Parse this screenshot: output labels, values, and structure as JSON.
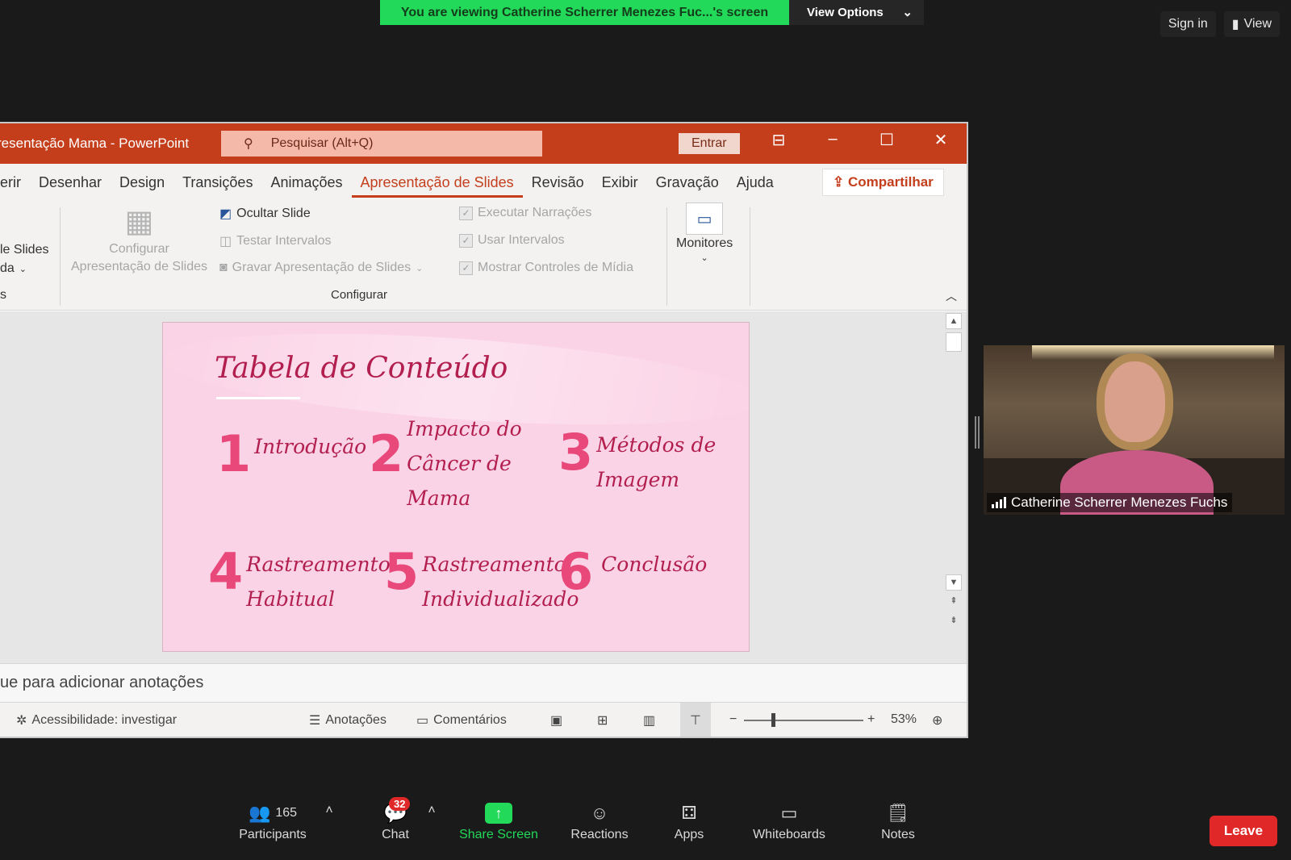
{
  "zoom": {
    "banner_text": "You are viewing Catherine Scherrer Menezes Fuc...'s screen",
    "view_options": "View Options",
    "sign_in": "Sign in",
    "view": "View",
    "participant_name": "Catherine Scherrer Menezes Fuchs",
    "toolbar": {
      "participants_label": "Participants",
      "participants_count": "165",
      "chat_label": "Chat",
      "chat_badge": "32",
      "share_label": "Share Screen",
      "reactions_label": "Reactions",
      "apps_label": "Apps",
      "whiteboards_label": "Whiteboards",
      "notes_label": "Notes",
      "leave_label": "Leave"
    }
  },
  "ppt": {
    "doc_title": "resentação Mama  -  PowerPoint",
    "search_placeholder": "Pesquisar (Alt+Q)",
    "entrar": "Entrar",
    "tabs": [
      "erir",
      "Desenhar",
      "Design",
      "Transições",
      "Animações",
      "Apresentação de Slides",
      "Revisão",
      "Exibir",
      "Gravação",
      "Ajuda"
    ],
    "share": "Compartilhar",
    "ribbon": {
      "left_cut_1": "le Slides",
      "left_cut_2": "da",
      "left_cut_3": "s",
      "configurar_line1": "Configurar",
      "configurar_line2": "Apresentação de Slides",
      "ocultar": "Ocultar Slide",
      "testar": "Testar Intervalos",
      "gravar": "Gravar Apresentação de Slides",
      "executar": "Executar Narrações",
      "usar": "Usar Intervalos",
      "mostrar": "Mostrar Controles de Mídia",
      "monitores": "Monitores",
      "group_label": "Configurar"
    },
    "slide": {
      "title": "Tabela de Conteúdo",
      "items": [
        {
          "num": "1",
          "label": "Introdução"
        },
        {
          "num": "2",
          "label": "Impacto do Câncer de Mama"
        },
        {
          "num": "3",
          "label": "Métodos de Imagem"
        },
        {
          "num": "4",
          "label": "Rastreamento Habitual"
        },
        {
          "num": "5",
          "label": "Rastreamento Individualizado"
        },
        {
          "num": "6",
          "label": "Conclusão"
        }
      ]
    },
    "notes_placeholder": "ue para adicionar anotações",
    "status": {
      "accessibility": "Acessibilidade: investigar",
      "anotacoes": "Anotações",
      "comentarios": "Comentários",
      "zoom_level": "53%"
    }
  }
}
